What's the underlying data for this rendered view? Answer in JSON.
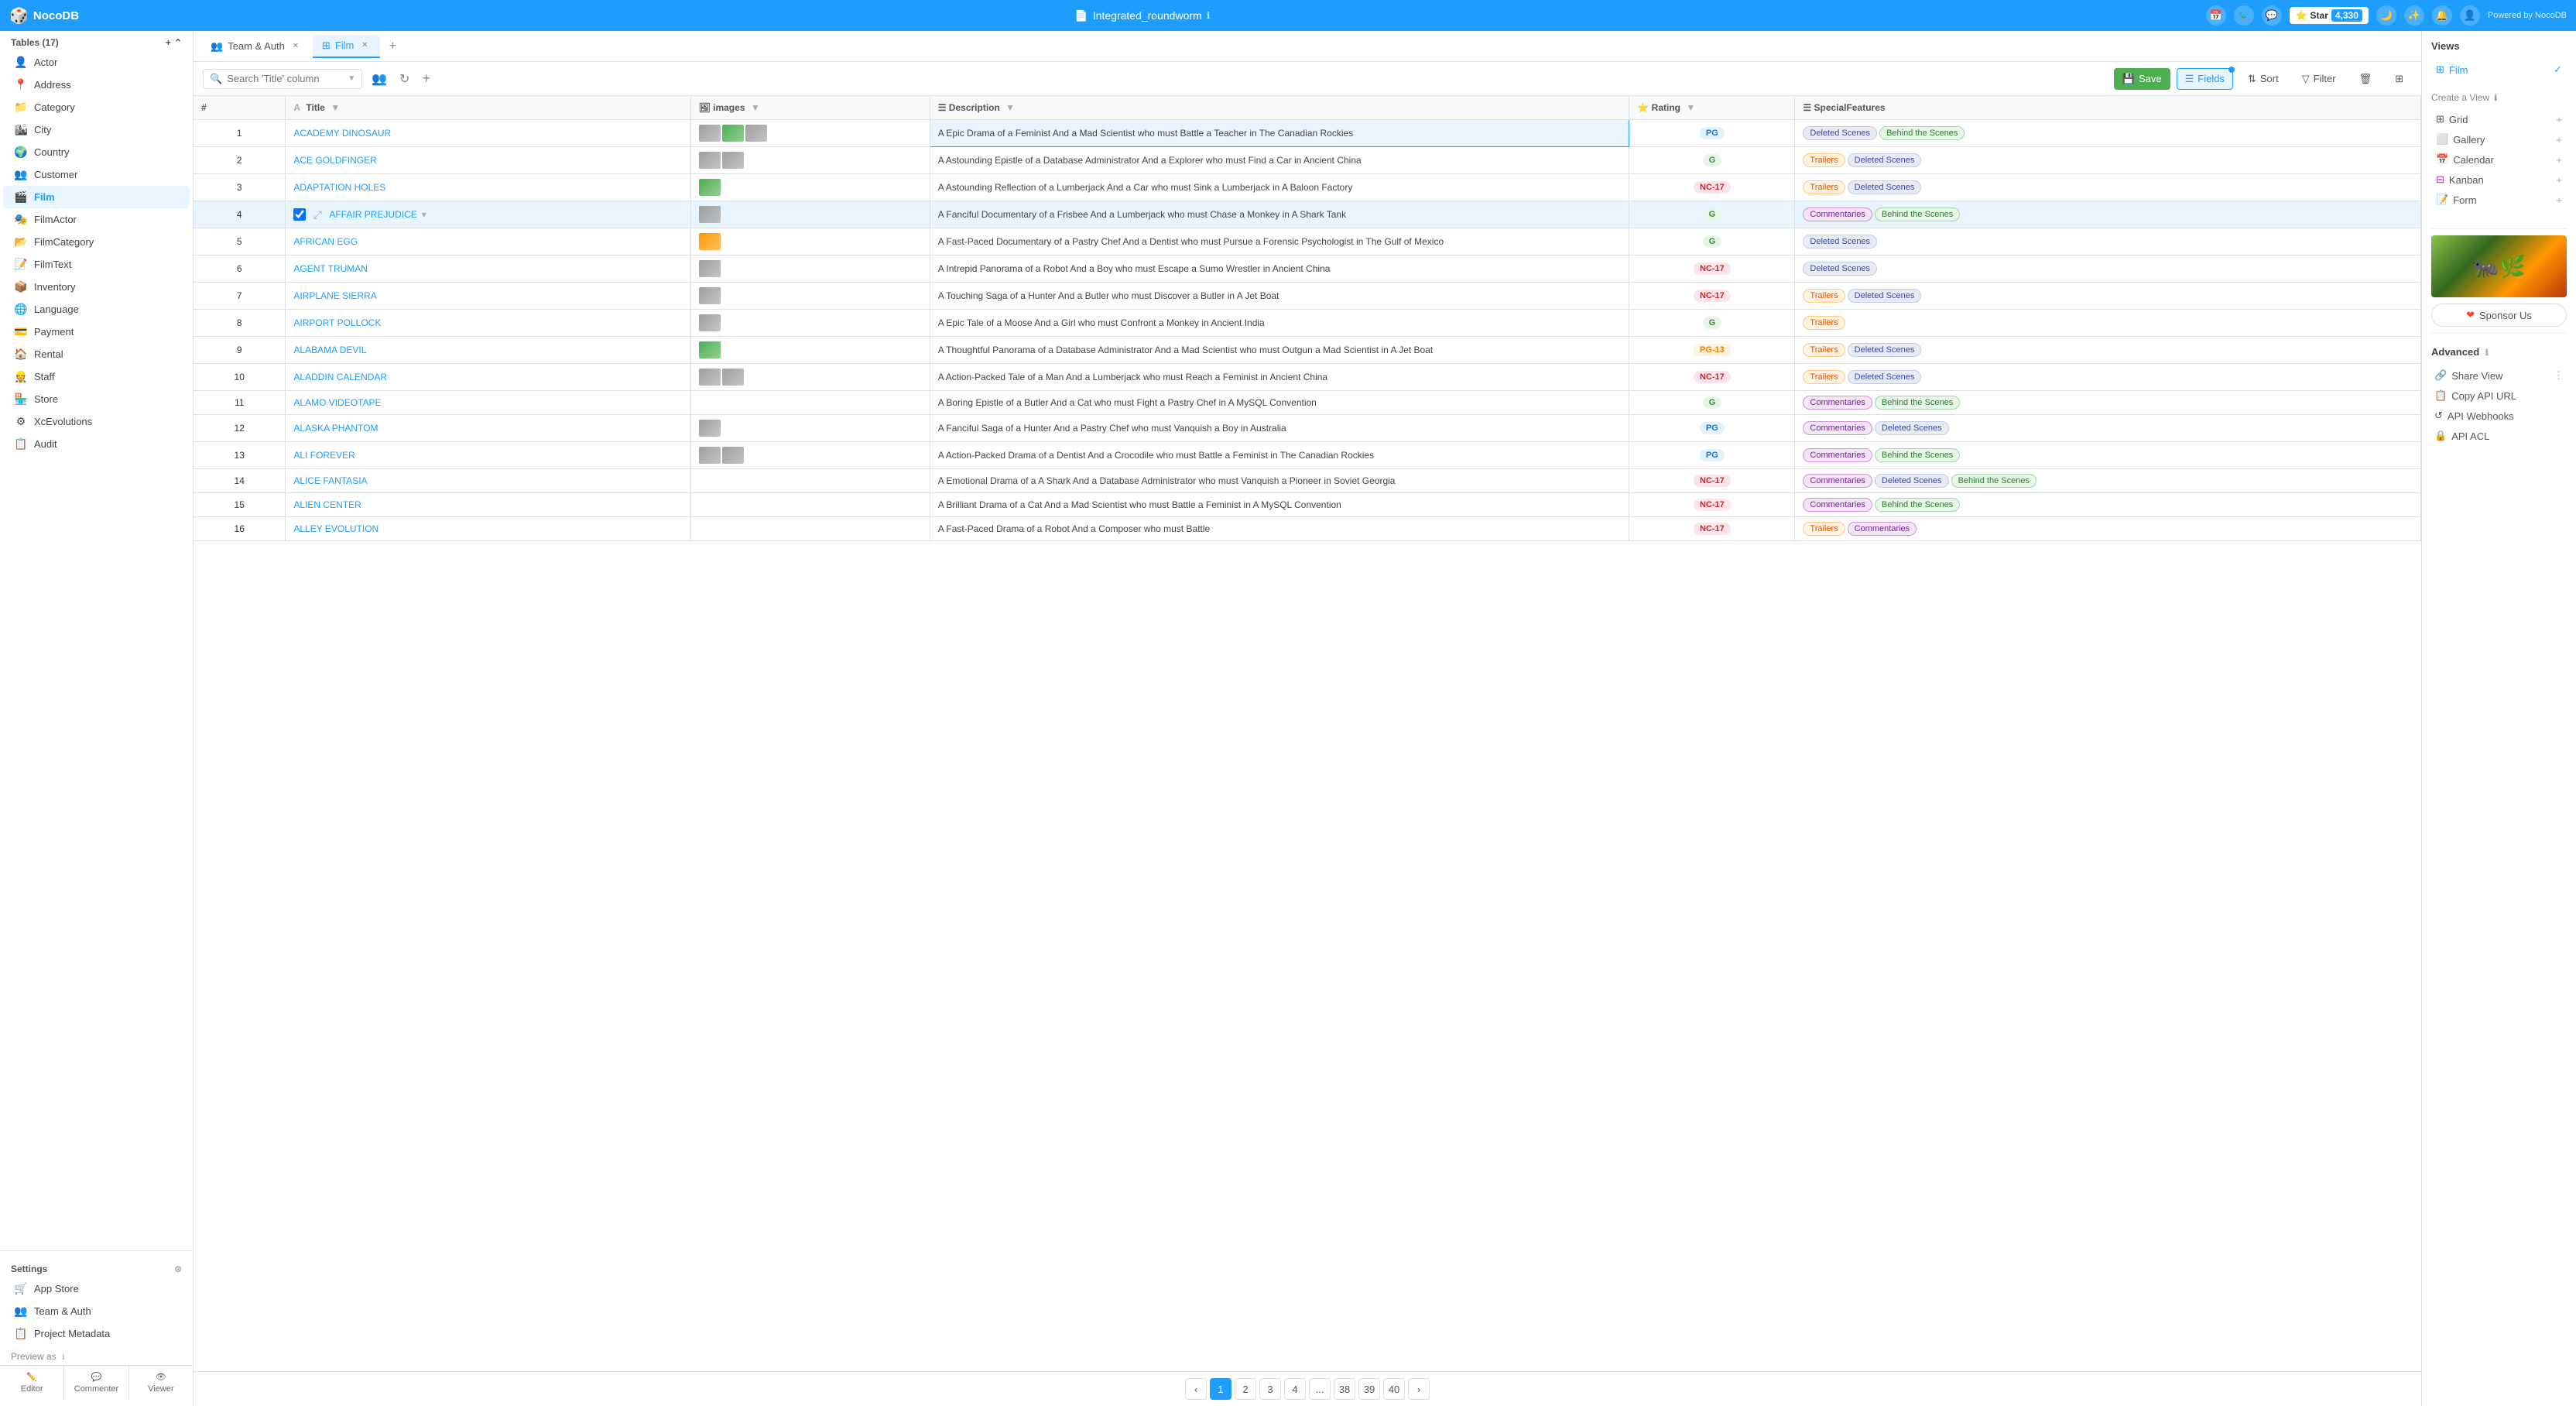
{
  "app": {
    "name": "NocoDB",
    "db_name": "Integrated_roundworm",
    "powered_by": "Powered by NocoDB",
    "star_label": "Star",
    "star_count": "4,330"
  },
  "tabs": [
    {
      "label": "Team & Auth",
      "active": false,
      "closable": true
    },
    {
      "label": "Film",
      "active": true,
      "closable": true
    }
  ],
  "toolbar": {
    "search_placeholder": "Search 'Title' column",
    "save_label": "Save",
    "fields_label": "Fields",
    "sort_label": "Sort",
    "filter_label": "Filter"
  },
  "table": {
    "columns": [
      "#",
      "Title",
      "images",
      "Description",
      "Rating",
      "SpecialFeatures"
    ],
    "rows": [
      {
        "num": 1,
        "title": "ACADEMY DINOSAUR",
        "description": "A Epic Drama of a Feminist And a Mad Scientist who must Battle a Teacher in The Canadian Rockies",
        "rating": "PG",
        "rating_class": "rating-pg",
        "features": [
          {
            "label": "Deleted Scenes",
            "class": "tag-deleted"
          },
          {
            "label": "Behind the Scenes",
            "class": "tag-behind"
          }
        ],
        "images": [
          "film",
          "green",
          "film"
        ],
        "highlight_desc": true
      },
      {
        "num": 2,
        "title": "ACE GOLDFINGER",
        "description": "A Astounding Epistle of a Database Administrator And a Explorer who must Find a Car in Ancient China",
        "rating": "G",
        "rating_class": "rating-g",
        "features": [
          {
            "label": "Trailers",
            "class": "tag-trailers"
          },
          {
            "label": "Deleted Scenes",
            "class": "tag-deleted"
          }
        ],
        "images": [
          "film",
          "film"
        ]
      },
      {
        "num": 3,
        "title": "ADAPTATION HOLES",
        "description": "A Astounding Reflection of a Lumberjack And a Car who must Sink a Lumberjack in A Baloon Factory",
        "rating": "NC-17",
        "rating_class": "rating-nc17",
        "features": [
          {
            "label": "Trailers",
            "class": "tag-trailers"
          },
          {
            "label": "Deleted Scenes",
            "class": "tag-deleted"
          }
        ],
        "images": [
          "green"
        ]
      },
      {
        "num": 4,
        "title": "AFFAIR PREJUDICE",
        "description": "A Fanciful Documentary of a Frisbee And a Lumberjack who must Chase a Monkey in A Shark Tank",
        "rating": "G",
        "rating_class": "rating-g",
        "features": [
          {
            "label": "Commentaries",
            "class": "tag-commentaries"
          },
          {
            "label": "Behind the Scenes",
            "class": "tag-behind"
          }
        ],
        "images": [
          "film"
        ],
        "selected": true
      },
      {
        "num": 5,
        "title": "AFRICAN EGG",
        "description": "A Fast-Paced Documentary of a Pastry Chef And a Dentist who must Pursue a Forensic Psychologist in The Gulf of Mexico",
        "rating": "G",
        "rating_class": "rating-g",
        "features": [
          {
            "label": "Deleted Scenes",
            "class": "tag-deleted"
          }
        ],
        "images": [
          "orange"
        ]
      },
      {
        "num": 6,
        "title": "AGENT TRUMAN",
        "description": "A Intrepid Panorama of a Robot And a Boy who must Escape a Sumo Wrestler in Ancient China",
        "rating": "NC-17",
        "rating_class": "rating-nc17",
        "features": [
          {
            "label": "Deleted Scenes",
            "class": "tag-deleted"
          }
        ],
        "images": [
          "film"
        ]
      },
      {
        "num": 7,
        "title": "AIRPLANE SIERRA",
        "description": "A Touching Saga of a Hunter And a Butler who must Discover a Butler in A Jet Boat",
        "rating": "NC-17",
        "rating_class": "rating-nc17",
        "features": [
          {
            "label": "Trailers",
            "class": "tag-trailers"
          },
          {
            "label": "Deleted Scenes",
            "class": "tag-deleted"
          }
        ],
        "images": [
          "film"
        ]
      },
      {
        "num": 8,
        "title": "AIRPORT POLLOCK",
        "description": "A Epic Tale of a Moose And a Girl who must Confront a Monkey in Ancient India",
        "rating": "G",
        "rating_class": "rating-g",
        "features": [
          {
            "label": "Trailers",
            "class": "tag-trailers"
          }
        ],
        "images": [
          "film"
        ]
      },
      {
        "num": 9,
        "title": "ALABAMA DEVIL",
        "description": "A Thoughtful Panorama of a Database Administrator And a Mad Scientist who must Outgun a Mad Scientist in A Jet Boat",
        "rating": "PG-13",
        "rating_class": "rating-pg13",
        "features": [
          {
            "label": "Trailers",
            "class": "tag-trailers"
          },
          {
            "label": "Deleted Scenes",
            "class": "tag-deleted"
          }
        ],
        "images": [
          "green"
        ]
      },
      {
        "num": 10,
        "title": "ALADDIN CALENDAR",
        "description": "A Action-Packed Tale of a Man And a Lumberjack who must Reach a Feminist in Ancient China",
        "rating": "NC-17",
        "rating_class": "rating-nc17",
        "features": [
          {
            "label": "Trailers",
            "class": "tag-trailers"
          },
          {
            "label": "Deleted Scenes",
            "class": "tag-deleted"
          }
        ],
        "images": [
          "film",
          "film"
        ]
      },
      {
        "num": 11,
        "title": "ALAMO VIDEOTAPE",
        "description": "A Boring Epistle of a Butler And a Cat who must Fight a Pastry Chef in A MySQL Convention",
        "rating": "G",
        "rating_class": "rating-g",
        "features": [
          {
            "label": "Commentaries",
            "class": "tag-commentaries"
          },
          {
            "label": "Behind the Scenes",
            "class": "tag-behind"
          }
        ],
        "images": []
      },
      {
        "num": 12,
        "title": "ALASKA PHANTOM",
        "description": "A Fanciful Saga of a Hunter And a Pastry Chef who must Vanquish a Boy in Australia",
        "rating": "PG",
        "rating_class": "rating-pg",
        "features": [
          {
            "label": "Commentaries",
            "class": "tag-commentaries"
          },
          {
            "label": "Deleted Scenes",
            "class": "tag-deleted"
          }
        ],
        "images": [
          "film"
        ]
      },
      {
        "num": 13,
        "title": "ALI FOREVER",
        "description": "A Action-Packed Drama of a Dentist And a Crocodile who must Battle a Feminist in The Canadian Rockies",
        "rating": "PG",
        "rating_class": "rating-pg",
        "features": [
          {
            "label": "Commentaries",
            "class": "tag-commentaries"
          },
          {
            "label": "Behind the Scenes",
            "class": "tag-behind"
          }
        ],
        "images": [
          "film",
          "film"
        ]
      },
      {
        "num": 14,
        "title": "ALICE FANTASIA",
        "description": "A Emotional Drama of a A Shark And a Database Administrator who must Vanquish a Pioneer in Soviet Georgia",
        "rating": "NC-17",
        "rating_class": "rating-nc17",
        "features": [
          {
            "label": "Commentaries",
            "class": "tag-commentaries"
          },
          {
            "label": "Deleted Scenes",
            "class": "tag-deleted"
          },
          {
            "label": "Behind the Scenes",
            "class": "tag-behind"
          }
        ],
        "images": []
      },
      {
        "num": 15,
        "title": "ALIEN CENTER",
        "description": "A Brilliant Drama of a Cat And a Mad Scientist who must Battle a Feminist in A MySQL Convention",
        "rating": "NC-17",
        "rating_class": "rating-nc17",
        "features": [
          {
            "label": "Commentaries",
            "class": "tag-commentaries"
          },
          {
            "label": "Behind the Scenes",
            "class": "tag-behind"
          }
        ],
        "images": []
      },
      {
        "num": 16,
        "title": "ALLEY EVOLUTION",
        "description": "A Fast-Paced Drama of a Robot And a Composer who must Battle",
        "rating": "NC-17",
        "rating_class": "rating-nc17",
        "features": [
          {
            "label": "Trailers",
            "class": "tag-trailers"
          },
          {
            "label": "Commentaries",
            "class": "tag-commentaries"
          }
        ],
        "images": []
      }
    ]
  },
  "pagination": {
    "pages": [
      "1",
      "2",
      "3",
      "4",
      "...",
      "38",
      "39",
      "40"
    ],
    "current": "1"
  },
  "views": {
    "title": "Views",
    "items": [
      {
        "label": "Film",
        "active": true
      }
    ],
    "create_label": "Create a View",
    "types": [
      {
        "label": "Grid",
        "icon": "grid"
      },
      {
        "label": "Gallery",
        "icon": "gallery"
      },
      {
        "label": "Calendar",
        "icon": "calendar"
      },
      {
        "label": "Kanban",
        "icon": "kanban"
      },
      {
        "label": "Form",
        "icon": "form"
      }
    ]
  },
  "advanced": {
    "title": "Advanced",
    "items": [
      {
        "label": "Share View"
      },
      {
        "label": "Copy API URL"
      },
      {
        "label": "API Webhooks"
      },
      {
        "label": "API ACL"
      }
    ]
  },
  "sponsor": {
    "label": "Sponsor Us"
  },
  "sidebar": {
    "tables_title": "Tables (17)",
    "tables": [
      {
        "label": "Actor"
      },
      {
        "label": "Address"
      },
      {
        "label": "Category"
      },
      {
        "label": "City"
      },
      {
        "label": "Country"
      },
      {
        "label": "Customer"
      },
      {
        "label": "Film",
        "active": true
      },
      {
        "label": "FilmActor"
      },
      {
        "label": "FilmCategory"
      },
      {
        "label": "FilmText"
      },
      {
        "label": "Inventory"
      },
      {
        "label": "Language"
      },
      {
        "label": "Payment"
      },
      {
        "label": "Rental"
      },
      {
        "label": "Staff"
      },
      {
        "label": "Store"
      },
      {
        "label": "XcEvolutions"
      }
    ],
    "other": [
      {
        "label": "Audit"
      }
    ],
    "settings_title": "Settings",
    "settings": [
      {
        "label": "App Store"
      },
      {
        "label": "Team & Auth"
      },
      {
        "label": "Project Metadata"
      }
    ],
    "preview_title": "Preview as",
    "preview_btns": [
      {
        "label": "Editor"
      },
      {
        "label": "Commenter"
      },
      {
        "label": "Viewer"
      }
    ]
  }
}
